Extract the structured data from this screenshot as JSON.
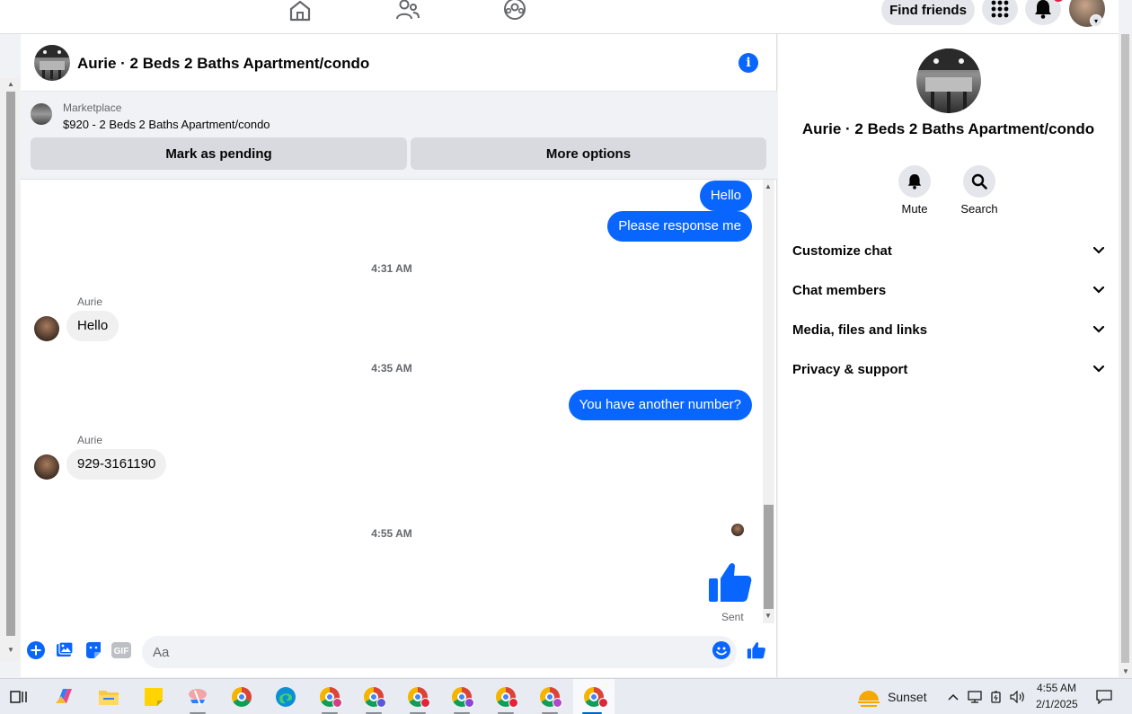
{
  "topnav": {
    "find_friends": "Find friends",
    "icons": [
      "home-icon",
      "friends-icon",
      "groups-icon",
      "menu-grid-icon",
      "bell-icon",
      "profile-avatar"
    ]
  },
  "chat": {
    "title": "Aurie · 2 Beds 2 Baths Apartment/condo",
    "marketplace": {
      "label": "Marketplace",
      "listing": "$920 - 2 Beds 2 Baths Apartment/condo",
      "mark_pending": "Mark as pending",
      "more_options": "More options"
    },
    "messages": {
      "out_hello": "Hello",
      "out_please": "Please response me",
      "ts1": "4:31 AM",
      "sender1": "Aurie",
      "in_hello": "Hello",
      "ts2": "4:35 AM",
      "out_number": "You have another number?",
      "sender2": "Aurie",
      "in_number": "929-3161190",
      "ts3": "4:55 AM",
      "sent": "Sent"
    },
    "composer": {
      "placeholder": "Aa",
      "gif": "GIF"
    }
  },
  "rpanel": {
    "title": "Aurie · 2 Beds 2 Baths Apartment/condo",
    "mute": "Mute",
    "search": "Search",
    "rows": [
      "Customize chat",
      "Chat members",
      "Media, files and links",
      "Privacy & support"
    ]
  },
  "taskbar": {
    "weather": "Sunset",
    "time": "4:55 AM",
    "date": "2/1/2025"
  },
  "colors": {
    "messenger_blue": "#0866ff",
    "bubble_gray": "#f0f0f0"
  }
}
